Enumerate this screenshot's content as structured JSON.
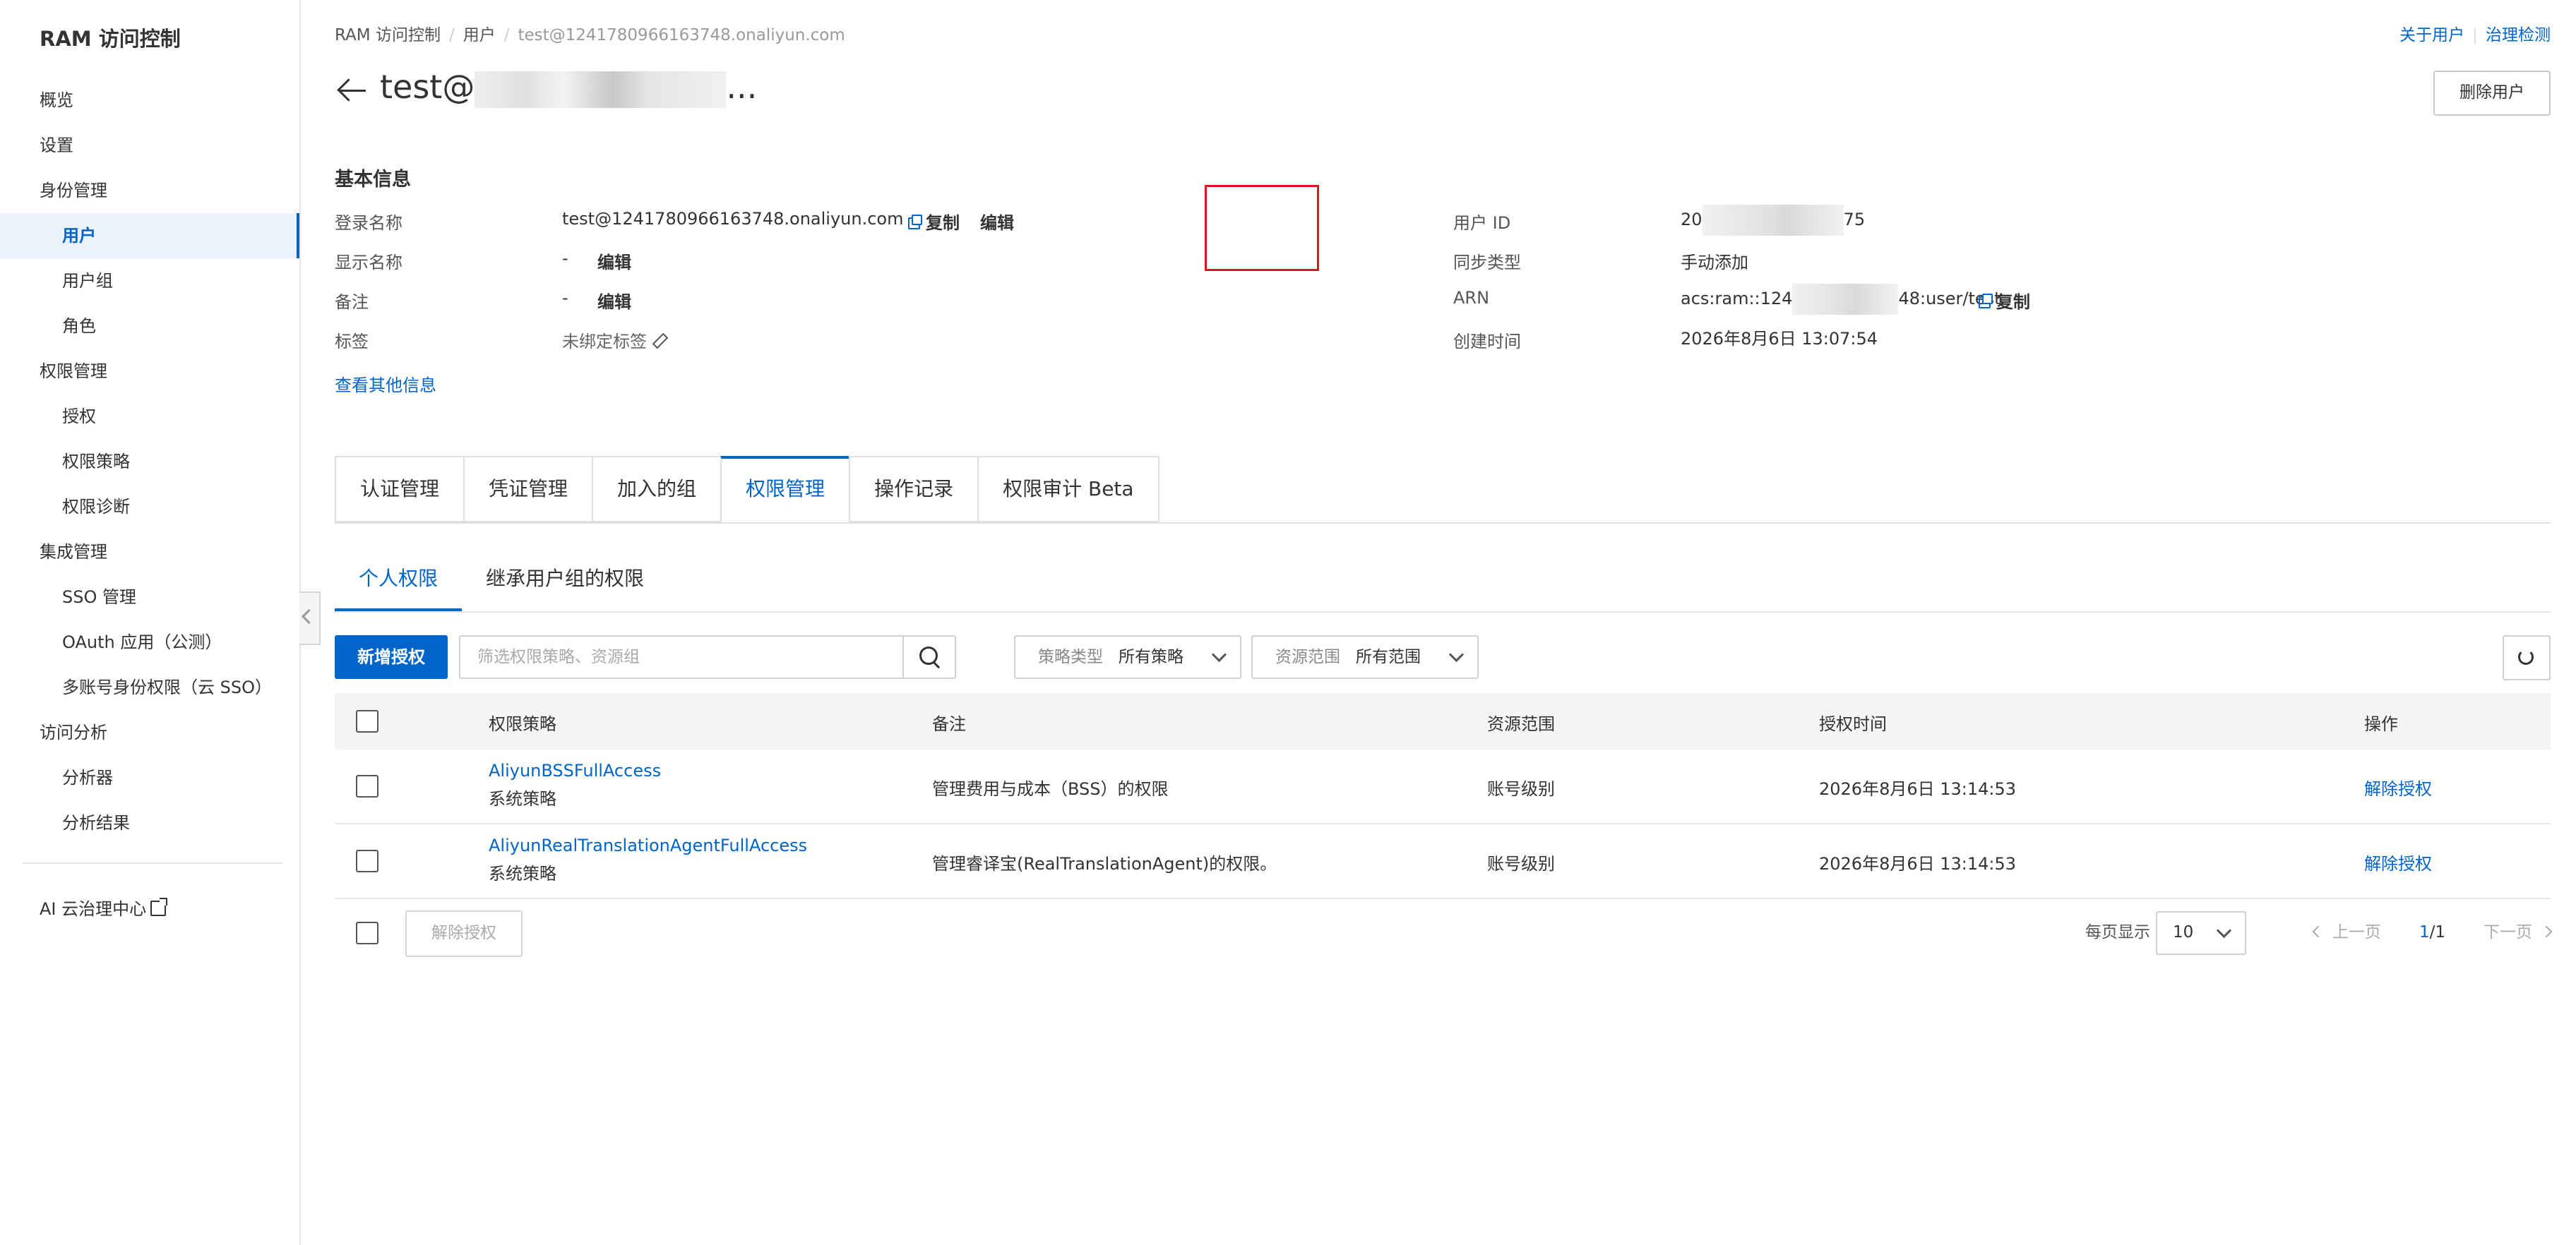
{
  "sidebar": {
    "title": "RAM 访问控制",
    "items": [
      {
        "label": "概览",
        "level": "top",
        "active": false
      },
      {
        "label": "设置",
        "level": "top",
        "active": false
      },
      {
        "label": "身份管理",
        "level": "top",
        "active": false
      },
      {
        "label": "用户",
        "level": "sub",
        "active": true
      },
      {
        "label": "用户组",
        "level": "sub",
        "active": false
      },
      {
        "label": "角色",
        "level": "sub",
        "active": false
      },
      {
        "label": "权限管理",
        "level": "top",
        "active": false
      },
      {
        "label": "授权",
        "level": "sub",
        "active": false
      },
      {
        "label": "权限策略",
        "level": "sub",
        "active": false
      },
      {
        "label": "权限诊断",
        "level": "sub",
        "active": false
      },
      {
        "label": "集成管理",
        "level": "top",
        "active": false
      },
      {
        "label": "SSO 管理",
        "level": "sub",
        "active": false
      },
      {
        "label": "OAuth 应用（公测）",
        "level": "sub",
        "active": false
      },
      {
        "label": "多账号身份权限（云 SSO）",
        "level": "sub",
        "active": false
      },
      {
        "label": "访问分析",
        "level": "top",
        "active": false
      },
      {
        "label": "分析器",
        "level": "sub",
        "active": false
      },
      {
        "label": "分析结果",
        "level": "sub",
        "active": false
      }
    ],
    "extra": "AI 云治理中心"
  },
  "breadcrumb": {
    "root": "RAM 访问控制",
    "section": "用户",
    "current": "test@1241780966163748.onaliyun.com"
  },
  "top_links": {
    "about": "关于用户",
    "governance": "治理检测"
  },
  "page_title": {
    "prefix": "test@",
    "suffix": "..."
  },
  "delete_user_button": "删除用户",
  "basic_info": {
    "title": "基本信息",
    "login_name": {
      "label": "登录名称",
      "value": "test@1241780966163748.onaliyun.com",
      "copy": "复制",
      "edit": "编辑"
    },
    "display_name": {
      "label": "显示名称",
      "value": "-",
      "edit": "编辑"
    },
    "remark": {
      "label": "备注",
      "value": "-",
      "edit": "编辑"
    },
    "tags": {
      "label": "标签",
      "value": "未绑定标签"
    },
    "more": "查看其他信息",
    "user_id": {
      "label": "用户 ID",
      "value_start": "20",
      "value_end": "75"
    },
    "sync_type": {
      "label": "同步类型",
      "value": "手动添加"
    },
    "arn": {
      "label": "ARN",
      "value_start": "acs:ram::124",
      "value_end": "48:user/test",
      "copy": "复制"
    },
    "created": {
      "label": "创建时间",
      "value": "2026年8月6日 13:07:54"
    }
  },
  "tabs": [
    {
      "label": "认证管理",
      "active": false
    },
    {
      "label": "凭证管理",
      "active": false
    },
    {
      "label": "加入的组",
      "active": false
    },
    {
      "label": "权限管理",
      "active": true
    },
    {
      "label": "操作记录",
      "active": false
    },
    {
      "label": "权限审计 Beta",
      "active": false
    }
  ],
  "subtabs": [
    {
      "label": "个人权限",
      "active": true
    },
    {
      "label": "继承用户组的权限",
      "active": false
    }
  ],
  "toolbar": {
    "add_button": "新增授权",
    "search_placeholder": "筛选权限策略、资源组",
    "policy_type": {
      "label": "策略类型",
      "value": "所有策略"
    },
    "scope": {
      "label": "资源范围",
      "value": "所有范围"
    }
  },
  "table": {
    "columns": [
      "权限策略",
      "备注",
      "资源范围",
      "授权时间",
      "操作"
    ],
    "rows": [
      {
        "policy": "AliyunBSSFullAccess",
        "type": "系统策略",
        "remark": "管理费用与成本（BSS）的权限",
        "scope": "账号级别",
        "time": "2026年8月6日 13:14:53",
        "action": "解除授权"
      },
      {
        "policy": "AliyunRealTranslationAgentFullAccess",
        "type": "系统策略",
        "remark": "管理睿译宝(RealTranslationAgent)的权限。",
        "scope": "账号级别",
        "time": "2026年8月6日 13:14:53",
        "action": "解除授权"
      }
    ]
  },
  "footer": {
    "bulk_revoke": "解除授权",
    "page_size_label": "每页显示",
    "page_size": "10",
    "prev": "上一页",
    "page_current": "1",
    "page_total": "/1",
    "next": "下一页"
  }
}
